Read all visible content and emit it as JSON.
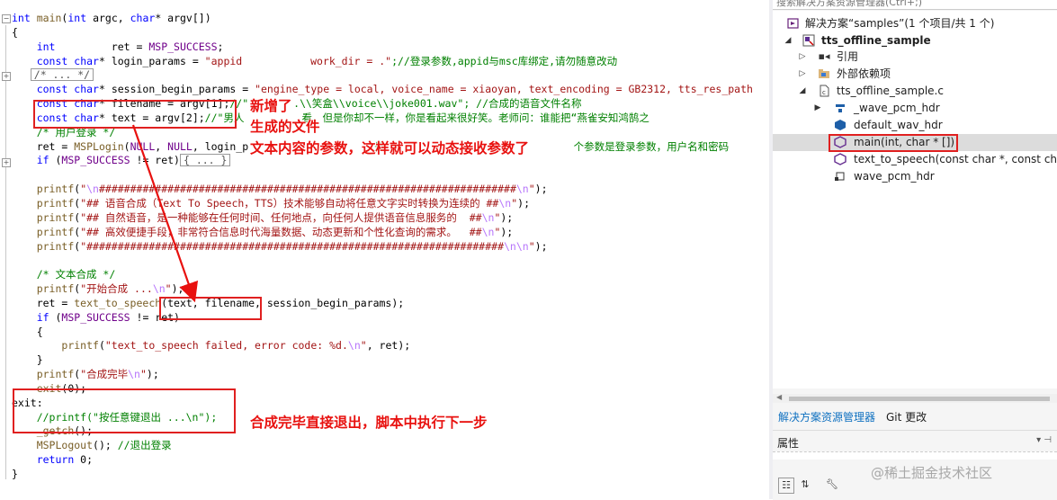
{
  "editor": {
    "lines": [
      [
        "int main(int argc, char* argv[])"
      ],
      [
        "{"
      ],
      [
        "    int         ret = MSP_SUCCESS;"
      ],
      [
        "    const char* login_params = \"appid  ",
        "work_dir = .\";//登录参数,appid与msc库绑定,请勿随意改动"
      ],
      [
        "/* ... */"
      ],
      [
        "    const char* session_begin_params = \"engine_type = local, voice_name = xiaoyan, text_encoding = GB2312, tts_res_path"
      ],
      [
        "    const char* filename = argv[1];//\"",
        ".\\\\笑盒\\\\voice\\\\joke001.wav\"; //合成的语音文件名称"
      ],
      [
        "    const char* text = argv[2];//\"男人",
        "看，但是你却不一样，你是看起来很好笑。老师问：谁能把“燕雀安知鸿鹄之"
      ],
      [
        "    /* 用户登录 */"
      ],
      [
        "    ret = MSPLogin(NULL, NULL, login_p",
        "是",
        "个参数是登录参数，用户名和密码"
      ],
      [
        "    if (MSP_SUCCESS != ret)",
        "{ ... }"
      ],
      [
        ""
      ],
      [
        "    printf(\"\\n###################################################################\\n\");"
      ],
      [
        "    printf(\"## 语音合成（Text To Speech，TTS）技术能够自动将任意文字实时转换为连续的 ##\\n\");"
      ],
      [
        "    printf(\"## 自然语音，是一种能够在任何时间、任何地点，向任何人提供语音信息服务的  ##\\n\");"
      ],
      [
        "    printf(\"## 高效便捷手段，非常符合信息时代海量数据、动态更新和个性化查询的需求。  ##\\n\");"
      ],
      [
        "    printf(\"###################################################################\\n\\n\");"
      ],
      [
        ""
      ],
      [
        "    /* 文本合成 */"
      ],
      [
        "    printf(\"开始合成 ...\\n\");"
      ],
      [
        "    ret = text_to_speech(text, filename, session_begin_params);"
      ],
      [
        "    if (MSP_SUCCESS != ret)"
      ],
      [
        "    {"
      ],
      [
        "        printf(\"text_to_speech failed, error code: %d.\\n\", ret);"
      ],
      [
        "    }"
      ],
      [
        "    printf(\"合成完毕\\n\");"
      ],
      [
        "    exit(0);"
      ],
      [
        "exit:"
      ],
      [
        "    //printf(\"按任意键退出 ...\\n\");"
      ],
      [
        "    _getch();"
      ],
      [
        "    MSPLogout(); //退出登录"
      ],
      [
        "    return 0;"
      ],
      [
        "}"
      ]
    ]
  },
  "annotations": {
    "added": "新增了",
    "generated_file": "生成的文件",
    "text_params": "文本内容的参数，这样就可以动态接收参数了",
    "exit_note": "合成完毕直接退出，脚本中执行下一步"
  },
  "solution_explorer": {
    "search_placeholder": "搜索解决方案资源管理器(Ctrl+;)",
    "items": [
      {
        "label": "解决方案“samples”(1 个项目/共 1 个)",
        "icon": "solution-icon"
      },
      {
        "label": "tts_offline_sample",
        "icon": "project-icon"
      },
      {
        "label": "引用",
        "icon": "references-icon"
      },
      {
        "label": "外部依赖项",
        "icon": "external-dependencies-icon"
      },
      {
        "label": "tts_offline_sample.c",
        "icon": "c-file-icon"
      },
      {
        "label": "_wave_pcm_hdr",
        "icon": "struct-icon"
      },
      {
        "label": "default_wav_hdr",
        "icon": "variable-icon"
      },
      {
        "label": "main(int, char * [])",
        "icon": "function-icon"
      },
      {
        "label": "text_to_speech(const char *, const char",
        "icon": "function-icon"
      },
      {
        "label": "wave_pcm_hdr",
        "icon": "typedef-icon"
      }
    ],
    "tabs": [
      "解决方案资源管理器",
      "Git 更改"
    ],
    "properties_title": "属性"
  },
  "watermark": "@稀土掘金技术社区",
  "colors": {
    "annotation_red": "#e8110f",
    "keyword_blue": "#0000ff",
    "string_red": "#a31515",
    "comment_green": "#008000",
    "active_tab_blue": "#0e70c0"
  }
}
